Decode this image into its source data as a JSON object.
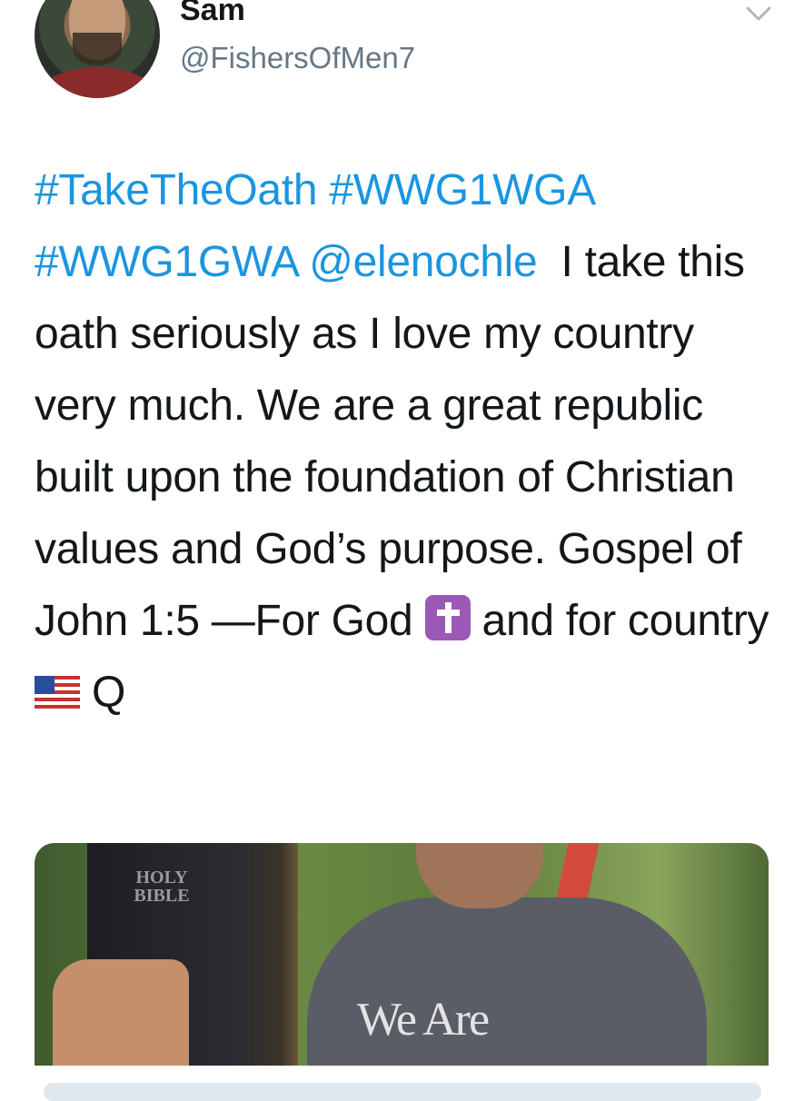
{
  "tweet": {
    "user_name": "Sam",
    "user_handle": "@FishersOfMen7",
    "text_parts": {
      "hashtag1": "#TakeTheOath",
      "hashtag2": "#WWG1WGA",
      "hashtag3": "#WWG1GWA",
      "mention": "@elenochle",
      "body1": "I take this oath seriously as I love my country very much. We are a great republic built upon the foundation of Christian values and God’s purpose. Gospel of John 1:5 —For God",
      "body2": "and for country",
      "body3": "Q"
    },
    "emojis": [
      "cross-emoji",
      "us-flag-emoji"
    ],
    "media": {
      "bible_title": "HOLY BIBLE",
      "shirt_text": "We Are"
    }
  },
  "colors": {
    "link": "#1b95e0",
    "text": "#14171a",
    "handle": "#657786"
  }
}
